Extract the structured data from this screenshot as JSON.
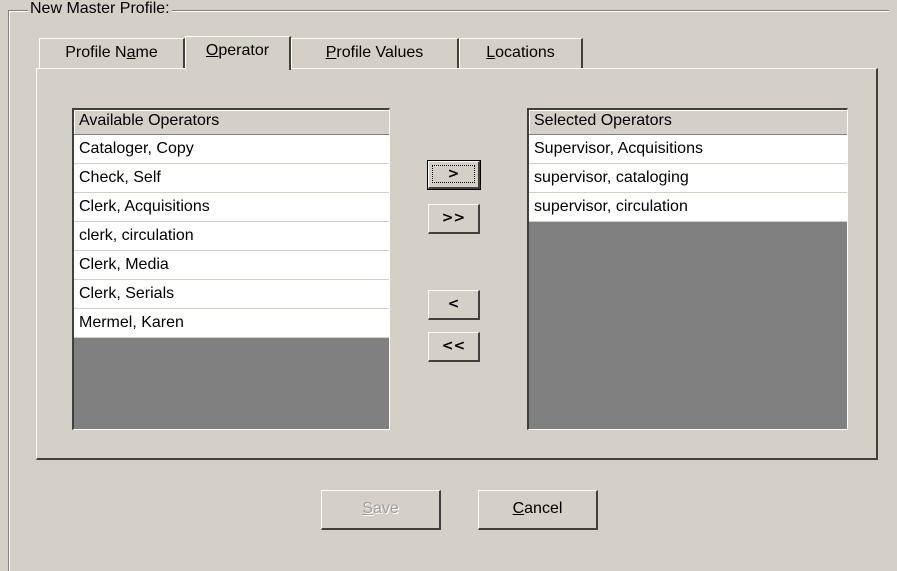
{
  "group": {
    "title": "New  Master Profile:"
  },
  "tabs": [
    {
      "label": "Profile Name",
      "accel": "a"
    },
    {
      "label": "Operator",
      "accel": "O"
    },
    {
      "label": "Profile Values",
      "accel": "P"
    },
    {
      "label": "Locations",
      "accel": "L"
    }
  ],
  "active_tab": "Operator",
  "available": {
    "header": "Available Operators",
    "items": [
      "Cataloger, Copy",
      "Check, Self",
      "Clerk, Acquisitions",
      "clerk, circulation",
      "Clerk, Media",
      "Clerk, Serials",
      "Mermel, Karen"
    ]
  },
  "selected": {
    "header": "Selected Operators",
    "items": [
      "Supervisor, Acquisitions",
      "supervisor, cataloging",
      "supervisor, circulation"
    ]
  },
  "move_buttons": {
    "add_one": ">",
    "add_all": ">>",
    "remove_one": "<",
    "remove_all": "<<"
  },
  "footer": {
    "save_label": "Save",
    "cancel_label": "Cancel"
  }
}
